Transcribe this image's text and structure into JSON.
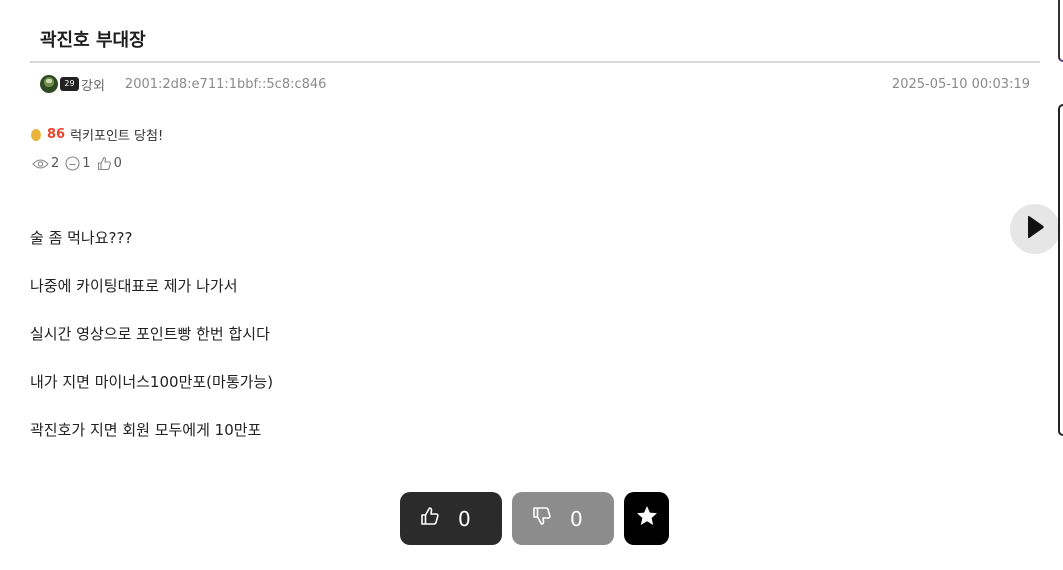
{
  "post": {
    "title": "곽진호 부대장",
    "author": "강외",
    "ip": "2001:2d8:e711:1bbf::5c8:c846",
    "date": "2025-05-10 00:03:19",
    "level_badge": "29"
  },
  "lucky": {
    "points": "86",
    "text": "럭키포인트 당첨!",
    "coin_color": "#e9b43a",
    "points_color": "#e8452c"
  },
  "stats": {
    "views": "2",
    "comments": "1",
    "likes": "0"
  },
  "content": [
    "술 좀 먹나요???",
    "나중에 카이팅대표로 제가 나가서",
    "실시간 영상으로 포인트빵 한번 합시다",
    "내가 지면 마이너스100만포(마통가능)",
    "곽진호가 지면 회원 모두에게 10만포"
  ],
  "votes": {
    "up": "0",
    "down": "0",
    "up_color": "#2b2b2b",
    "down_color": "#8c8c8c"
  },
  "icons": [
    "avatar",
    "coin-icon",
    "eye-icon",
    "comment-icon",
    "thumbs-up-icon",
    "thumbs-down-icon",
    "star-icon",
    "play-icon"
  ]
}
